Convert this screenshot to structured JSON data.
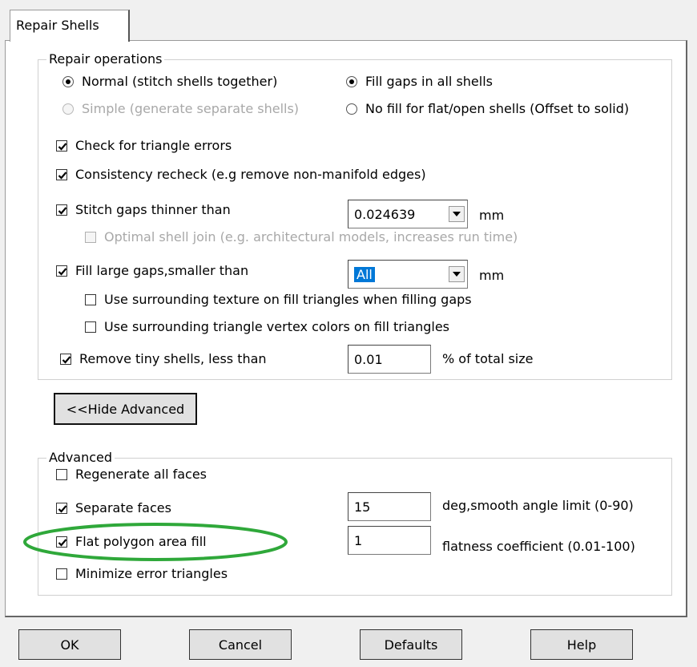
{
  "tab": {
    "label": "Repair Shells"
  },
  "repair_operations": {
    "legend": "Repair operations",
    "radio_normal": "Normal (stitch shells together)",
    "radio_simple": "Simple (generate separate shells)",
    "radio_fill_all": "Fill gaps in all shells",
    "radio_no_fill": "No fill for flat/open shells (Offset to solid)",
    "check_triangle": "Check for triangle errors",
    "check_consistency": "Consistency recheck (e.g remove non-manifold edges)",
    "check_stitch": "Stitch gaps thinner than",
    "stitch_value": "0.024639",
    "stitch_unit": "mm",
    "check_optimal": "Optimal shell join (e.g. architectural models, increases run time)",
    "check_fill_large": "Fill large gaps,smaller than",
    "fill_large_value": "All",
    "fill_large_unit": "mm",
    "check_texture": "Use surrounding texture on fill triangles when filling gaps",
    "check_vertex_colors": "Use surrounding triangle vertex colors on fill triangles",
    "check_remove_tiny": "Remove tiny shells, less than",
    "remove_tiny_value": "0.01",
    "remove_tiny_unit": "% of total size"
  },
  "hide_advanced_button": "<<Hide Advanced",
  "advanced": {
    "legend": "Advanced",
    "check_regenerate": "Regenerate all faces",
    "check_separate": "Separate faces",
    "separate_value": "15",
    "separate_unit": "deg,smooth angle limit (0-90)",
    "check_flat_polygon": "Flat polygon area fill",
    "flat_value": "1",
    "flat_unit": "flatness coefficient (0.01-100)",
    "check_minimize": "Minimize error triangles"
  },
  "buttons": {
    "ok": "OK",
    "cancel": "Cancel",
    "defaults": "Defaults",
    "help": "Help"
  },
  "colors": {
    "highlight_ellipse": "#2fa83a",
    "selection": "#0078d7"
  }
}
